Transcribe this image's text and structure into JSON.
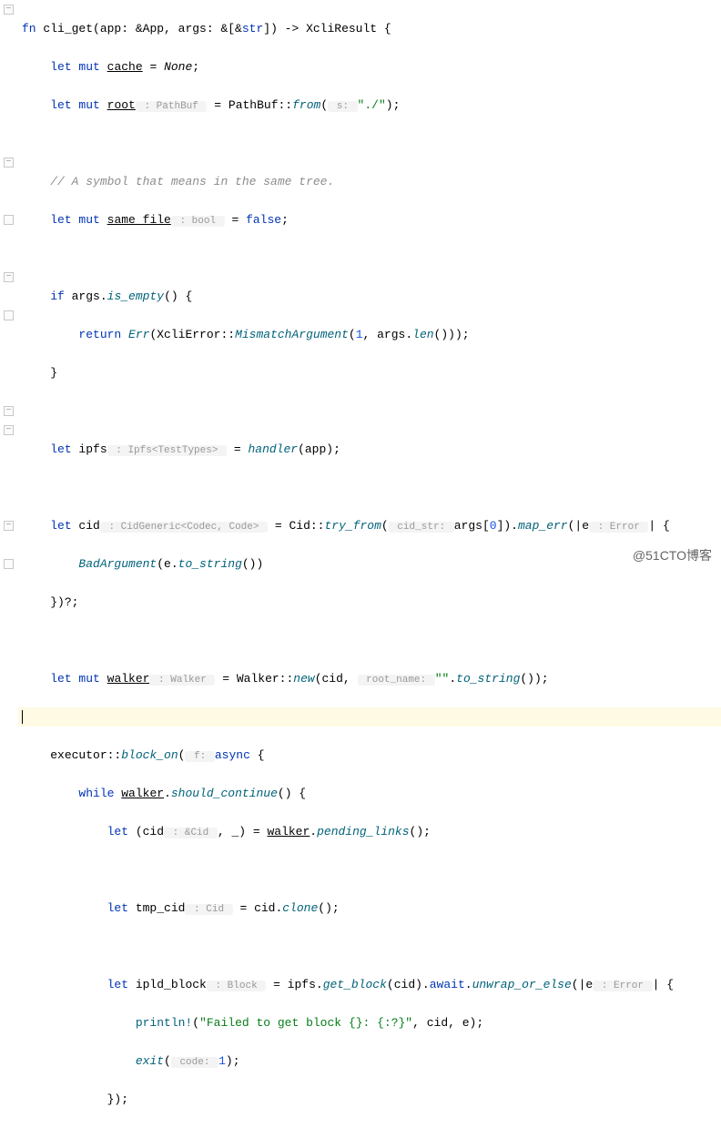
{
  "code": {
    "fn_sig": {
      "kw1": "fn",
      "name": "cli_get",
      "params": "(app: &App, args: &[&",
      "str_kw": "str",
      "params2": "]) -> XcliResult {"
    },
    "l2": {
      "kw": "let mut",
      "var": "cache",
      "eq": " = ",
      "val": "None",
      "end": ";"
    },
    "l3": {
      "kw": "let mut",
      "var": "root",
      "hint": " : PathBuf ",
      "eq": " = PathBuf::",
      "call": "from",
      "op": "(",
      "hint2": " s: ",
      "str": "\"./\"",
      "end": ");"
    },
    "l5": {
      "comment": "// A symbol that means in the same tree."
    },
    "l6": {
      "kw": "let mut",
      "var": "same_file",
      "hint": " : bool ",
      "eq": " = ",
      "kw2": "false",
      "end": ";"
    },
    "l8": {
      "kw": "if",
      "expr": " args.",
      "call": "is_empty",
      "end": "() {"
    },
    "l9": {
      "kw": "return",
      "sp": " ",
      "err": "Err",
      "op": "(XcliError::",
      "variant": "MismatchArgument",
      "op2": "(",
      "num": "1",
      "txt": ", args.",
      "call": "len",
      "end": "()));"
    },
    "l10": {
      "brace": "}"
    },
    "l12": {
      "kw": "let",
      "var": " ipfs",
      "hint": " : Ipfs<TestTypes> ",
      "eq": " = ",
      "call": "handler",
      "end": "(app);"
    },
    "l14": {
      "kw": "let",
      "var": " cid",
      "hint": " : CidGeneric<Codec, Code> ",
      "eq": " = Cid::",
      "call": "try_from",
      "op": "(",
      "hint2": " cid_str: ",
      "txt": "args[",
      "num": "0",
      "txt2": "]).",
      "call2": "map_err",
      "txt3": "(|e",
      "hint3": " : Error ",
      "end": "| {"
    },
    "l15": {
      "variant": "BadArgument",
      "txt": "(e.",
      "call": "to_string",
      "end": "())"
    },
    "l16": {
      "brace": "})?;"
    },
    "l18": {
      "kw": "let mut",
      "var": "walker",
      "hint": " : Walker ",
      "eq": " = Walker::",
      "call": "new",
      "txt": "(cid, ",
      "hint2": " root_name: ",
      "str": "\"\"",
      "txt2": ".",
      "call2": "to_string",
      "end": "());"
    },
    "l20": {
      "txt": "executor::",
      "call": "block_on",
      "op": "(",
      "hint": " f: ",
      "kw": "async",
      "end": " {"
    },
    "l21": {
      "kw": "while",
      "txt": " ",
      "var": "walker",
      "txt2": ".",
      "call": "should_continue",
      "end": "() {"
    },
    "l22": {
      "kw": "let",
      "txt": " (cid",
      "hint": " : &Cid ",
      "txt2": ", _) = ",
      "var": "walker",
      "txt3": ".",
      "call": "pending_links",
      "end": "();"
    },
    "l24": {
      "kw": "let",
      "txt": " tmp_cid",
      "hint": " : Cid ",
      "eq": " = cid.",
      "call": "clone",
      "end": "();"
    },
    "l26": {
      "kw": "let",
      "txt": " ipld_block",
      "hint": " : Block ",
      "eq": " = ipfs.",
      "call": "get_block",
      "txt2": "(cid).",
      "kw2": "await",
      "txt3": ".",
      "call2": "unwrap_or_else",
      "txt4": "(|e",
      "hint2": " : Error ",
      "end": "| {"
    },
    "l27": {
      "macro": "println!",
      "op": "(",
      "str": "\"Failed to get block {}: {:?}\"",
      "end": ", cid, e);"
    },
    "l28": {
      "call": "exit",
      "op": "(",
      "hint": " code: ",
      "num": "1",
      "end": ");"
    },
    "l29": {
      "brace": "});"
    }
  },
  "watermark": "@51CTO博客"
}
